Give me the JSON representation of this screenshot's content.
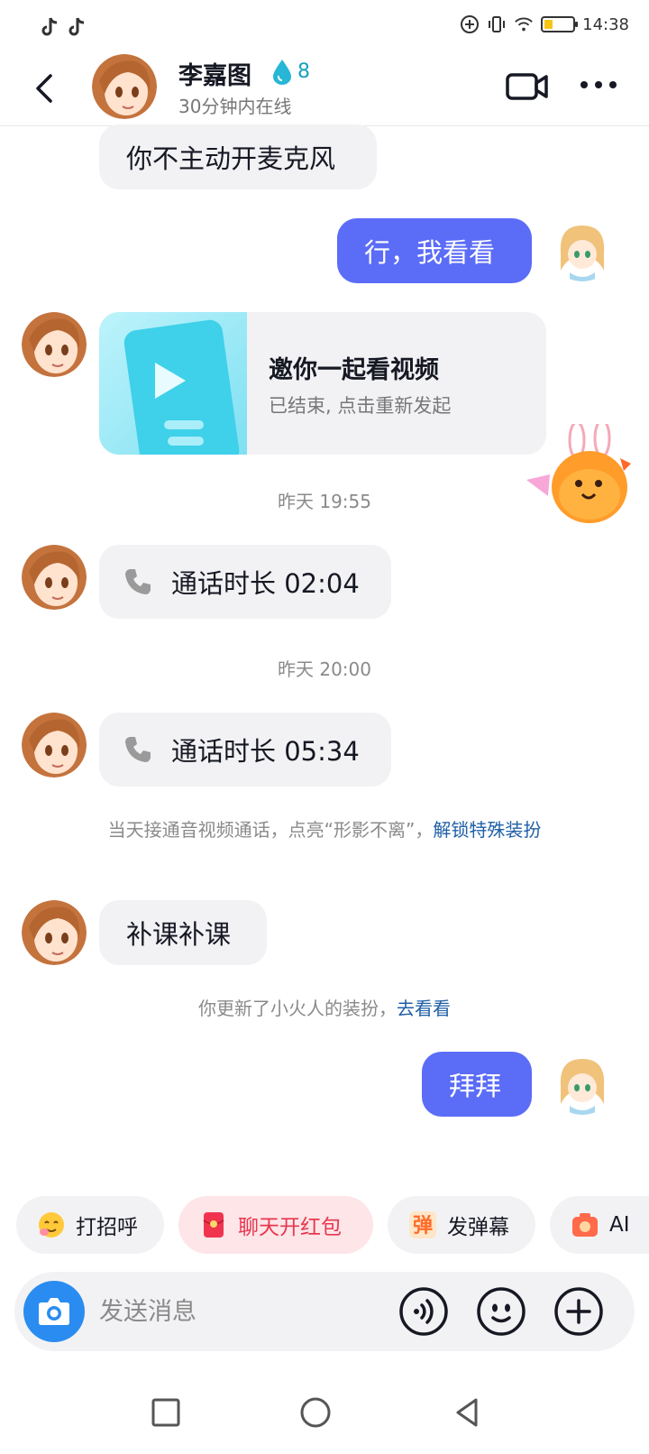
{
  "status_bar": {
    "time": "14:38",
    "left_icons": [
      "tiktok-icon",
      "tiktok-icon"
    ],
    "right_icons": [
      "add-circle-icon",
      "vibrate-icon",
      "wifi-icon",
      "battery-icon"
    ]
  },
  "header": {
    "name": "李嘉图",
    "streak_count": "8",
    "status": "30分钟内在线"
  },
  "messages": {
    "m1": "你不主动开麦克风",
    "m2": "行，我看看",
    "invite": {
      "title": "邀你一起看视频",
      "subtitle": "已结束, 点击重新发起"
    },
    "time1": "昨天 19:55",
    "call1": "通话时长 02:04",
    "time2": "昨天 20:00",
    "call2": "通话时长 05:34",
    "sys1": {
      "text": "当天接通音视频通话，点亮“形影不离”，",
      "link": "解锁特殊装扮"
    },
    "m3": "补课补课",
    "sys2": {
      "text": "你更新了小火人的装扮，",
      "link": "去看看"
    },
    "m4": "拜拜"
  },
  "quick_actions": [
    {
      "label": "打招呼",
      "icon": "wave-emoji-icon"
    },
    {
      "label": "聊天开红包",
      "icon": "red-envelope-icon"
    },
    {
      "label": "发弹幕",
      "icon": "danmu-icon"
    },
    {
      "label": "AI",
      "icon": "ai-camera-icon"
    }
  ],
  "input": {
    "placeholder": "发送消息"
  },
  "colors": {
    "accent": "#5b6cf7",
    "link": "#1f5fa6",
    "bubble_in": "#f2f2f4"
  }
}
